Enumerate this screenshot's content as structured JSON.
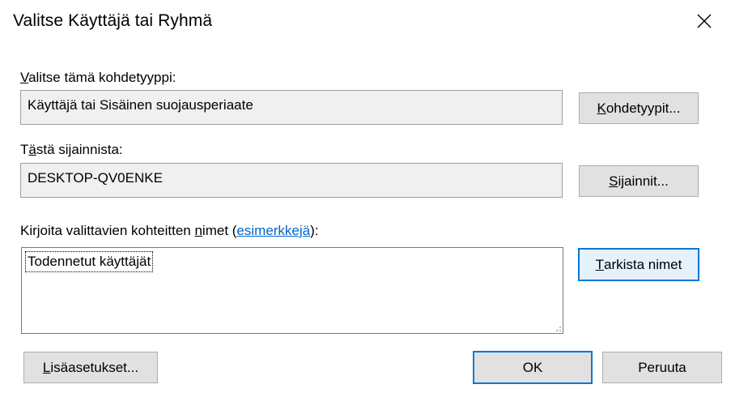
{
  "window": {
    "title": "Valitse Käyttäjä tai Ryhmä",
    "close_icon": "close-icon"
  },
  "object_type": {
    "label_access": "V",
    "label_rest": "alitse tämä kohdetyyppi:",
    "value": "Käyttäjä tai Sisäinen suojausperiaate",
    "button_access": "K",
    "button_rest": "ohdetyypit..."
  },
  "location": {
    "label_pre": "T",
    "label_access": "ä",
    "label_rest": "stä sijainnista:",
    "value": "DESKTOP-QV0ENKE",
    "button_access": "S",
    "button_rest": "ijainnit..."
  },
  "names": {
    "label_pre": "Kirjoita valittavien kohteitten ",
    "label_access": "n",
    "label_rest": "imet (",
    "link_text": "esimerkkejä",
    "label_end": "):",
    "value": "Todennetut käyttäjät",
    "check_button_access": "T",
    "check_button_rest": "arkista nimet"
  },
  "footer": {
    "advanced_access": "L",
    "advanced_rest": "isäasetukset...",
    "ok_label": "OK",
    "cancel_label": "Peruuta"
  },
  "colors": {
    "accent": "#0078d7",
    "link": "#0066cc",
    "button_face": "#e1e1e1",
    "readonly_face": "#f0f0f0"
  }
}
